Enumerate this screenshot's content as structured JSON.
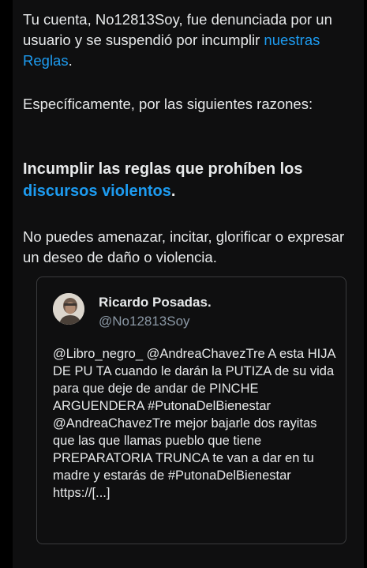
{
  "notice": {
    "intro_before_link": "Tu cuenta, No12813Soy, fue denunciada por un usuario y se suspendió por incumplir ",
    "rules_link": "nuestras Reglas",
    "intro_after_link": ".",
    "reasons_intro": "Específicamente, por las siguientes razones:",
    "violation_before_link": "Incumplir las reglas que prohíben los ",
    "violation_link": "discursos violentos",
    "violation_after_link": ".",
    "violation_detail": "No puedes amenazar, incitar, glorificar o expresar un deseo de daño o violencia."
  },
  "tweet": {
    "author_name": "Ricardo Posadas.",
    "author_handle": "@No12813Soy",
    "text": "@Libro_negro_ @AndreaChavezTre A esta HIJA DE PU TA cuando le darán la PUTIZA de su vida para que deje de andar de PINCHE ARGUENDERA #PutonaDelBienestar @AndreaChavezTre mejor bajarle dos rayitas que las que llamas pueblo que tiene PREPARATORIA TRUNCA te van a dar en tu madre y estarás de #PutonaDelBienestar https://[...]"
  },
  "colors": {
    "background": "#0f0f10",
    "text": "#e7e9ea",
    "link": "#1d9bf0",
    "secondary": "#8b98a5",
    "border": "#3a3b3d"
  }
}
